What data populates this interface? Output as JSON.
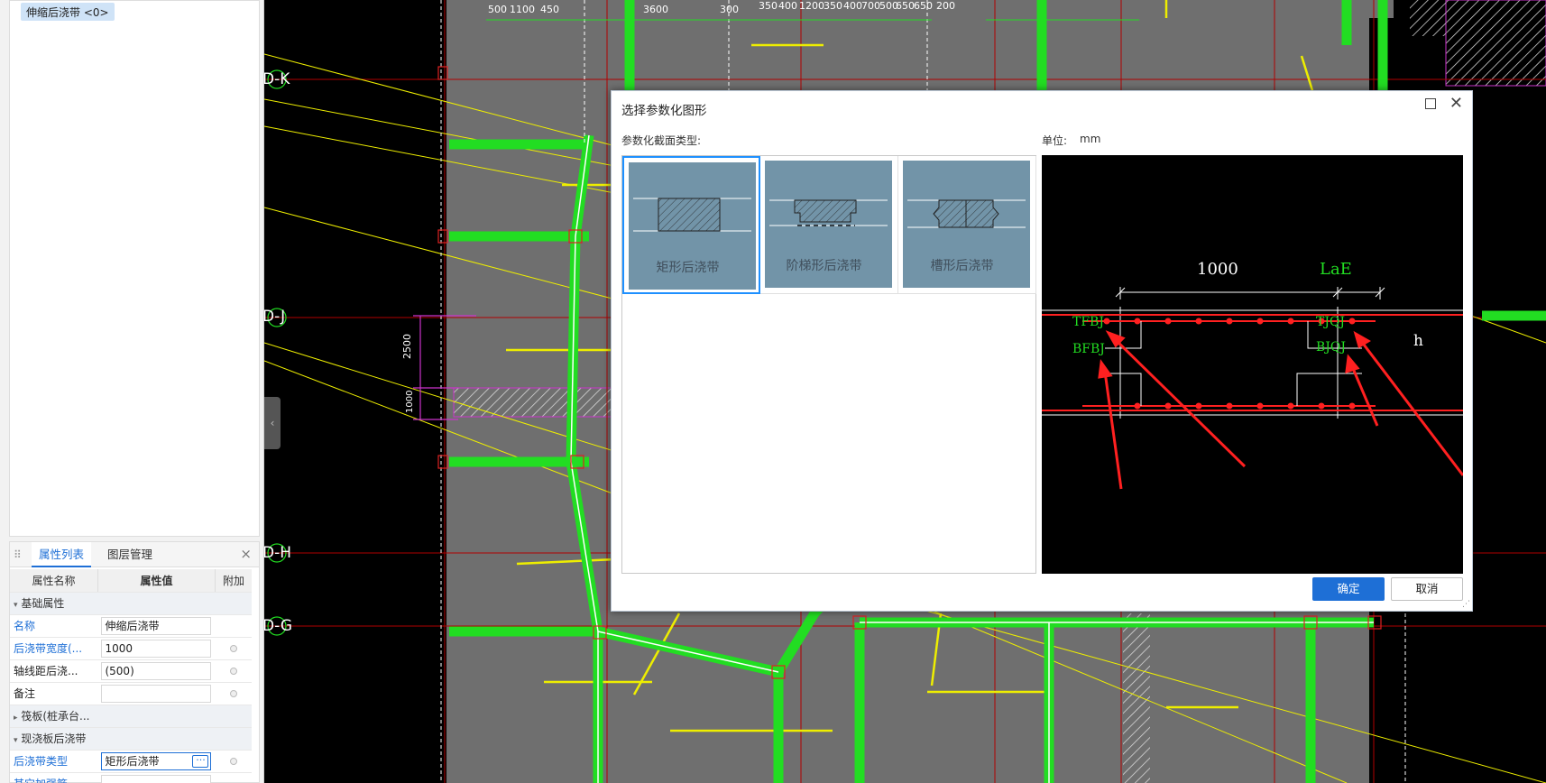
{
  "tree": {
    "item": "伸缩后浇带 <0>"
  },
  "properties": {
    "tabs": [
      "属性列表",
      "图层管理"
    ],
    "headers": [
      "属性名称",
      "属性值",
      "附加"
    ],
    "groups": {
      "basic": "基础属性",
      "raft": "筏板(桩承台...",
      "cast": "现浇板后浇带"
    },
    "rows": [
      {
        "name": "名称",
        "value": "伸缩后浇带"
      },
      {
        "name": "后浇带宽度(...",
        "value": "1000"
      },
      {
        "name": "轴线距后浇...",
        "value": "(500)"
      },
      {
        "name": "备注",
        "value": ""
      },
      {
        "name": "后浇带类型",
        "value": "矩形后浇带"
      },
      {
        "name": "其它加强筋",
        "value": ""
      }
    ],
    "dots": "···"
  },
  "cad": {
    "axes": [
      "D-K",
      "D-J",
      "D-H",
      "D-G"
    ],
    "dims_top": [
      "500",
      "1100",
      "450",
      "3600",
      "300",
      "350",
      "400",
      "1200",
      "350",
      "400",
      "700",
      "500",
      "650",
      "650",
      "200"
    ],
    "dims_left": [
      "2500",
      "1000"
    ]
  },
  "dialog": {
    "title": "选择参数化图形",
    "type_label": "参数化截面类型:",
    "unit_label": "单位:",
    "unit_value": "mm",
    "cards": [
      {
        "label": "矩形后浇带"
      },
      {
        "label": "阶梯形后浇带"
      },
      {
        "label": "槽形后浇带"
      }
    ],
    "preview": {
      "width_dim": "1000",
      "lae": "LaE",
      "tfbj": "TFBJ",
      "bfbj": "BFBJ",
      "tjqj": "TJQJ",
      "bjqj": "BJQJ",
      "h": "h"
    },
    "ok": "确定",
    "cancel": "取消"
  },
  "colors": {
    "accent": "#1e6fd6",
    "green": "#22dd22",
    "yellow": "#eeee00",
    "red": "#cc0000",
    "slab": "#6f6f6f",
    "thumb": "#7294a8"
  }
}
